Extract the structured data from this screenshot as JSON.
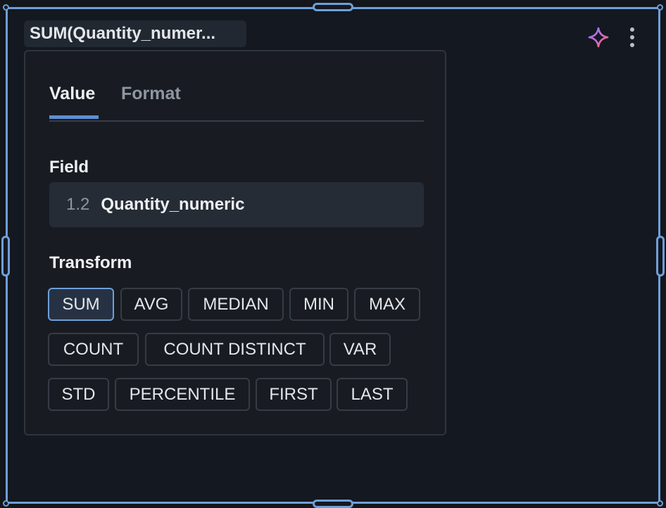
{
  "widget": {
    "title": "SUM(Quantity_numer...",
    "ai_icon": "sparkle-icon",
    "menu_icon": "kebab-menu-icon",
    "accent_color": "#6e9fd8"
  },
  "popover": {
    "tabs": [
      {
        "label": "Value",
        "active": true
      },
      {
        "label": "Format",
        "active": false
      }
    ],
    "field": {
      "section_label": "Field",
      "type_glyph": "1.2",
      "name": "Quantity_numeric"
    },
    "transform": {
      "section_label": "Transform",
      "selected": "SUM",
      "options": [
        "SUM",
        "AVG",
        "MEDIAN",
        "MIN",
        "MAX",
        "COUNT",
        "COUNT DISTINCT",
        "VAR",
        "STD",
        "PERCENTILE",
        "FIRST",
        "LAST"
      ]
    }
  }
}
